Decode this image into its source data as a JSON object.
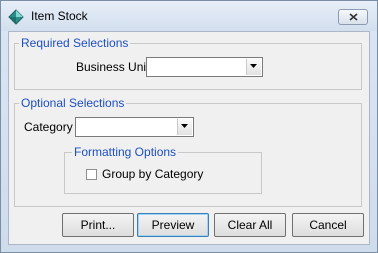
{
  "window": {
    "title": "Item Stock",
    "icon": "diamond-app-icon",
    "close_icon": "close-icon"
  },
  "required": {
    "legend": "Required Selections",
    "business_unit_label": "Business Unit",
    "business_unit_value": ""
  },
  "optional": {
    "legend": "Optional Selections",
    "category_label": "Category",
    "category_value": "",
    "formatting": {
      "legend": "Formatting Options",
      "group_by_label": "Group by Category",
      "group_by_checked": false
    }
  },
  "buttons": {
    "print": "Print...",
    "preview": "Preview",
    "clear_all": "Clear All",
    "cancel": "Cancel"
  },
  "colors": {
    "legend_text": "#1c4fc4",
    "title_bar": "#d3dfee"
  }
}
